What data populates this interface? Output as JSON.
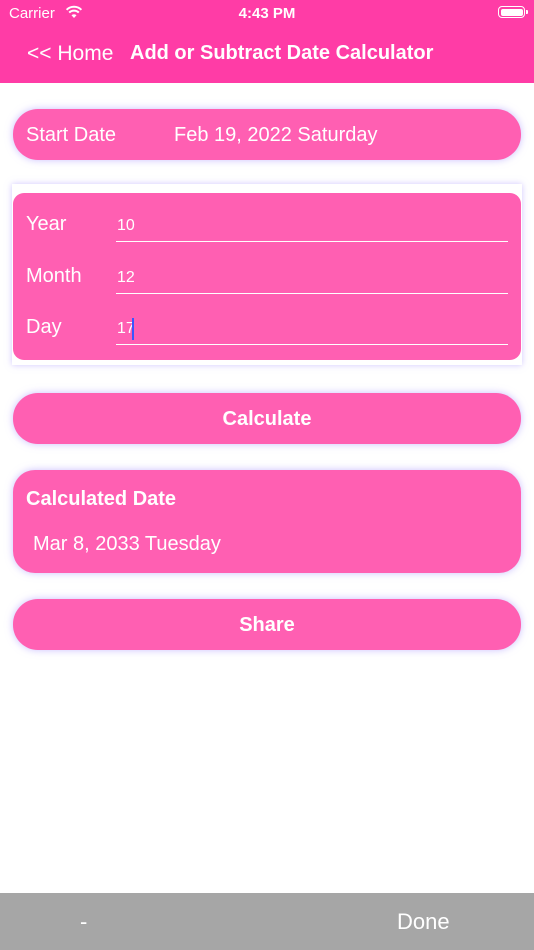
{
  "status_bar": {
    "carrier": "Carrier",
    "time": "4:43 PM"
  },
  "nav": {
    "back_label": "<< Home",
    "title": "Add or Subtract Date Calculator"
  },
  "start_date": {
    "label": "Start Date",
    "value": "Feb 19, 2022 Saturday"
  },
  "inputs": {
    "year": {
      "label": "Year",
      "value": "10"
    },
    "month": {
      "label": "Month",
      "value": "12"
    },
    "day": {
      "label": "Day",
      "value": "17"
    }
  },
  "calculate_label": "Calculate",
  "result": {
    "title": "Calculated Date",
    "value": "Mar 8, 2033 Tuesday"
  },
  "share_label": "Share",
  "keyboard_toolbar": {
    "minus_label": "-",
    "done_label": "Done"
  },
  "colors": {
    "header": "#ff3ca6",
    "card": "#ff5fb2",
    "toolbar": "#a6a6a6"
  }
}
